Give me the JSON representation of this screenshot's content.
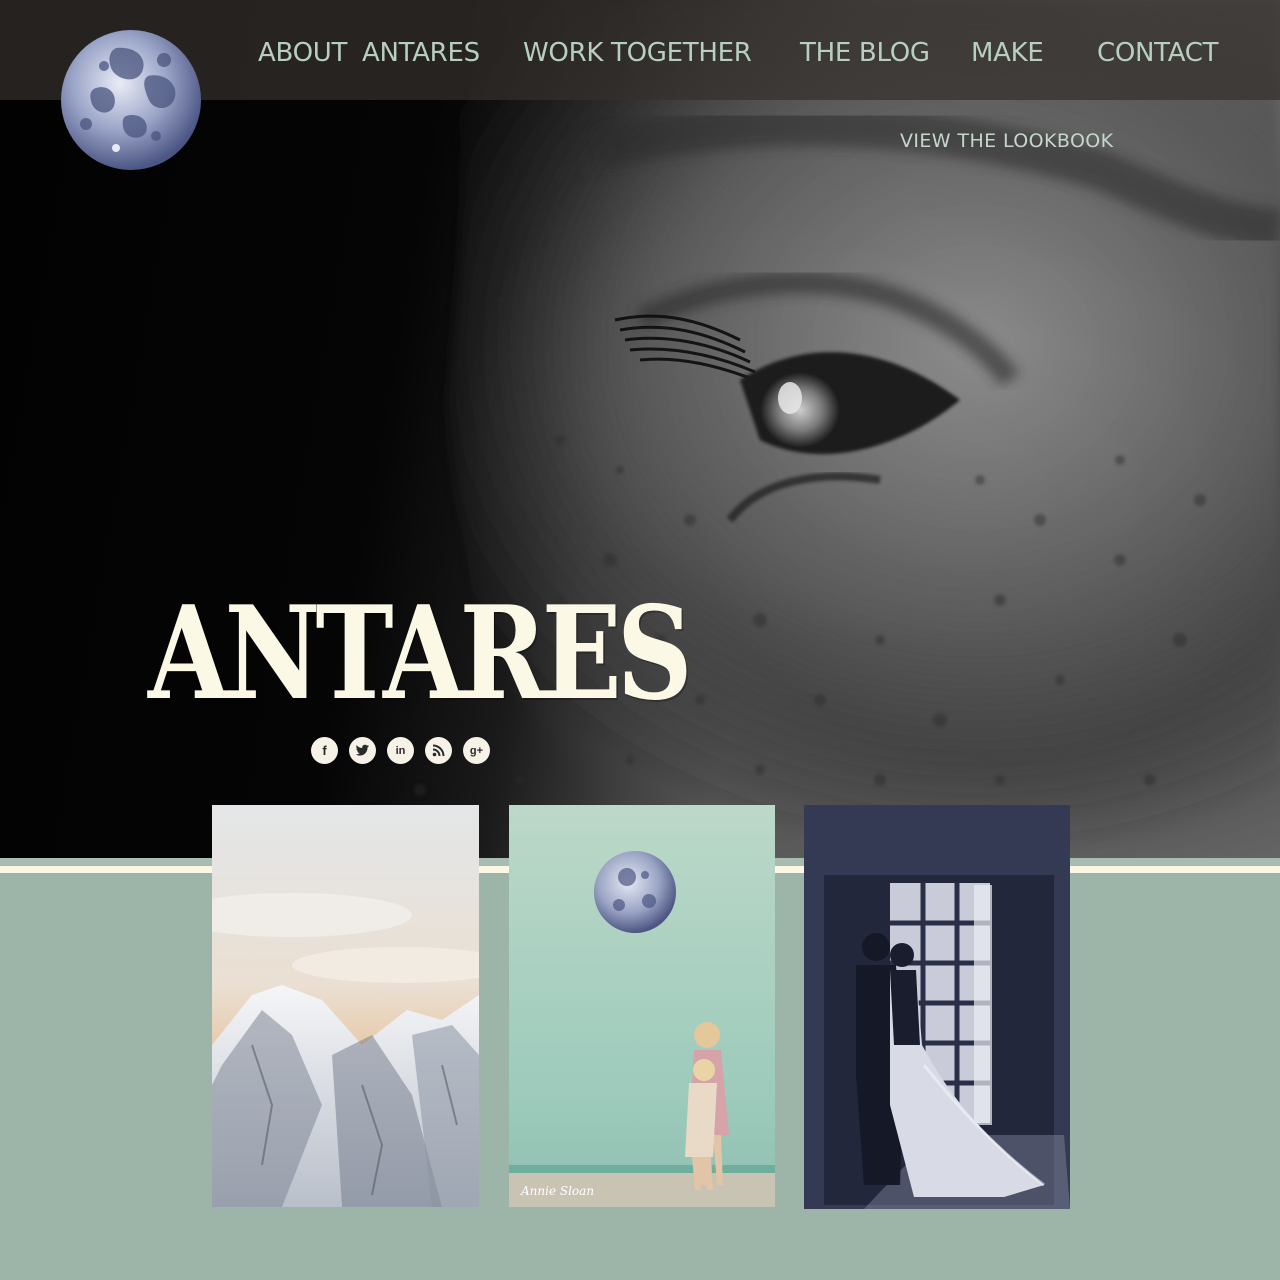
{
  "nav": {
    "items": [
      {
        "id": "about",
        "label": "ABOUT"
      },
      {
        "id": "antares",
        "label": "ANTARES"
      },
      {
        "id": "work",
        "label": "WORK  TOGETHER"
      },
      {
        "id": "blog",
        "label": "THE BLOG"
      },
      {
        "id": "make",
        "label": "MAKE"
      },
      {
        "id": "contact",
        "label": "CONTACT"
      }
    ],
    "lookbook": "VIEW  THE  LOOKBOOK"
  },
  "hero": {
    "brand": "ANTARES"
  },
  "social": [
    {
      "icon": "facebook-icon",
      "glyph": "f"
    },
    {
      "icon": "twitter-icon",
      "glyph": "t"
    },
    {
      "icon": "linkedin-icon",
      "glyph": "in"
    },
    {
      "icon": "rss-icon",
      "glyph": "◔"
    },
    {
      "icon": "googleplus-icon",
      "glyph": "g+"
    }
  ],
  "gallery": {
    "cards": [
      {
        "subject": "snowy-mountains"
      },
      {
        "subject": "children-by-wall",
        "signature": "Annie Sloan"
      },
      {
        "subject": "couple-silhouette"
      }
    ]
  },
  "colors": {
    "nav_text": "#b7cfbf",
    "brand_text": "#fbf8e6",
    "sage": "#9db5a8",
    "cream": "#fbf7e4",
    "navy_card": "#353a54"
  }
}
